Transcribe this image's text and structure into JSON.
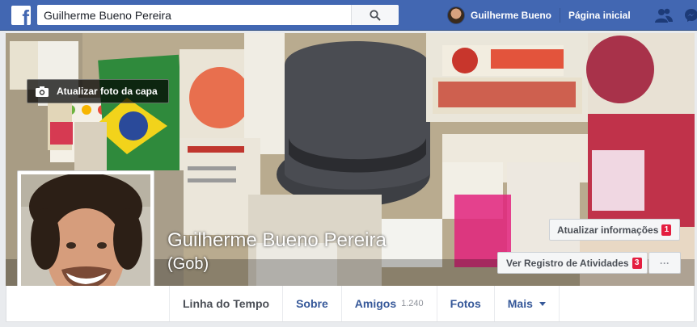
{
  "topbar": {
    "logo_icon": "facebook-f-logo",
    "search": {
      "value": "Guilherme Bueno Pereira",
      "icon": "search-icon"
    },
    "user_name": "Guilherme Bueno",
    "home_label": "Página inicial",
    "icons": [
      "friend-requests-icon",
      "messenger-icon"
    ],
    "brand_color": "#4267b2"
  },
  "cover": {
    "update_cover_label": "Atualizar foto da capa",
    "camera_icon": "camera-icon"
  },
  "profile": {
    "name": "Guilherme Bueno Pereira",
    "alternate_name": "(Gob)"
  },
  "actions": {
    "update_info_label": "Atualizar informações",
    "update_info_badge": "1",
    "activity_log_label": "Ver Registro de Atividades",
    "activity_log_badge": "3",
    "more_label": "···"
  },
  "tabs": {
    "timeline": "Linha do Tempo",
    "about": "Sobre",
    "friends": "Amigos",
    "friends_count": "1.240",
    "photos": "Fotos",
    "more": "Mais"
  }
}
